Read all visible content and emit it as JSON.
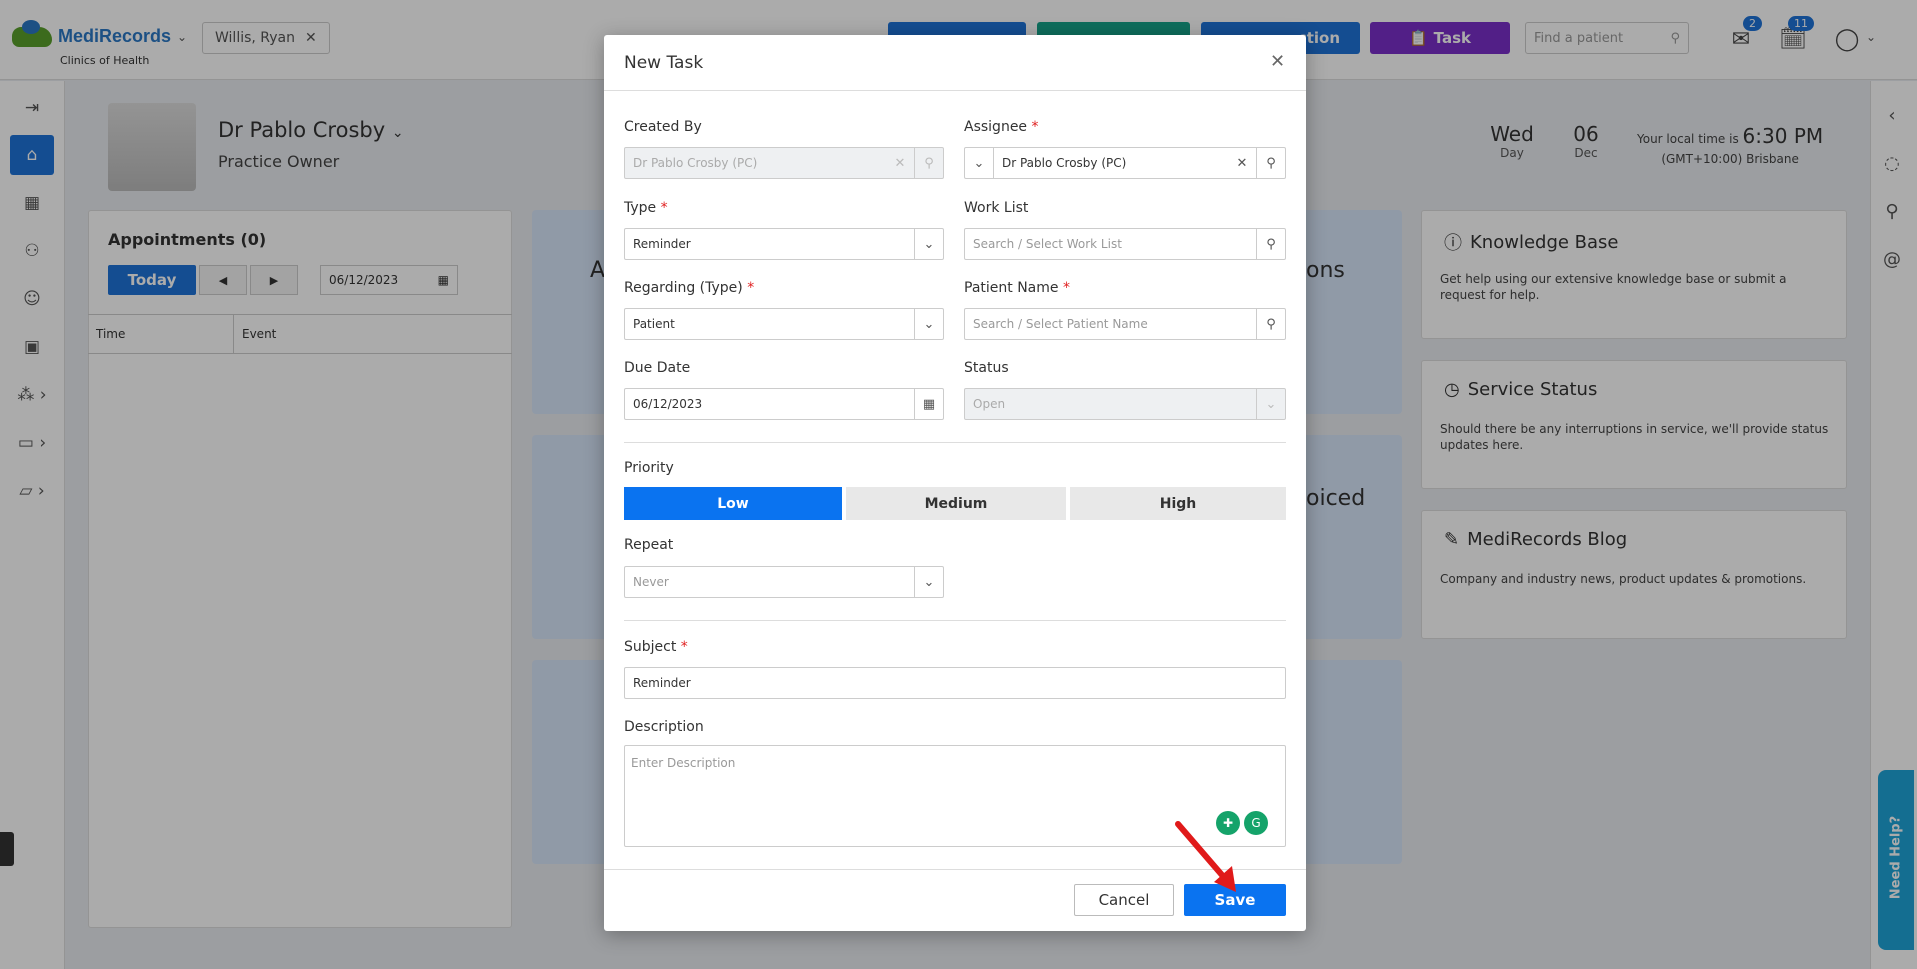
{
  "app": {
    "logo_name": "MediRecords",
    "logo_sub": "Clinics of Health"
  },
  "topbar": {
    "patient_chip": "Willis, Ryan",
    "buttons": [
      {
        "label": "",
        "color": "#1e73d8"
      },
      {
        "label": "",
        "color": "#16a38a"
      },
      {
        "label": "ction",
        "color": "#1e73d8"
      },
      {
        "label": "Task",
        "color": "#7b2fc9"
      }
    ],
    "search_placeholder": "Find a patient",
    "mail_badge": "2",
    "tasks_badge": "11"
  },
  "header": {
    "doctor_name": "Dr Pablo Crosby",
    "doctor_role": "Practice Owner",
    "day_name": "Wed",
    "day_label": "Day",
    "date_num": "06",
    "month_label": "Dec",
    "localtime_prefix": "Your local time is",
    "localtime": "6:30 PM",
    "timezone": "(GMT+10:00) Brisbane"
  },
  "appointments": {
    "title": "Appointments (0)",
    "today_label": "Today",
    "date": "06/12/2023",
    "col_time": "Time",
    "col_event": "Event"
  },
  "tiles": {
    "tile1_left": "A",
    "tile1_right": "ons",
    "tile2_right": "oiced"
  },
  "info_panels": [
    {
      "title": "Knowledge Base",
      "text": "Get help using our extensive knowledge base or submit a request for help."
    },
    {
      "title": "Service Status",
      "text": "Should there be any interruptions in service, we'll provide status updates here."
    },
    {
      "title": "MediRecords Blog",
      "text": "Company and industry news, product updates & promotions."
    }
  ],
  "need_help": "Need Help?",
  "modal": {
    "title": "New Task",
    "created_by_label": "Created By",
    "created_by_value": "Dr Pablo Crosby (PC)",
    "assignee_label": "Assignee",
    "assignee_value": "Dr Pablo Crosby (PC)",
    "type_label": "Type",
    "type_value": "Reminder",
    "worklist_label": "Work List",
    "worklist_placeholder": "Search / Select Work List",
    "regarding_label": "Regarding (Type)",
    "regarding_value": "Patient",
    "patient_name_label": "Patient Name",
    "patient_name_placeholder": "Search / Select Patient Name",
    "due_date_label": "Due Date",
    "due_date_value": "06/12/2023",
    "status_label": "Status",
    "status_value": "Open",
    "priority_label": "Priority",
    "priority_options": [
      "Low",
      "Medium",
      "High"
    ],
    "priority_selected": "Low",
    "repeat_label": "Repeat",
    "repeat_value": "Never",
    "subject_label": "Subject",
    "subject_value": "Reminder",
    "description_label": "Description",
    "description_placeholder": "Enter Description",
    "cancel_label": "Cancel",
    "save_label": "Save"
  }
}
